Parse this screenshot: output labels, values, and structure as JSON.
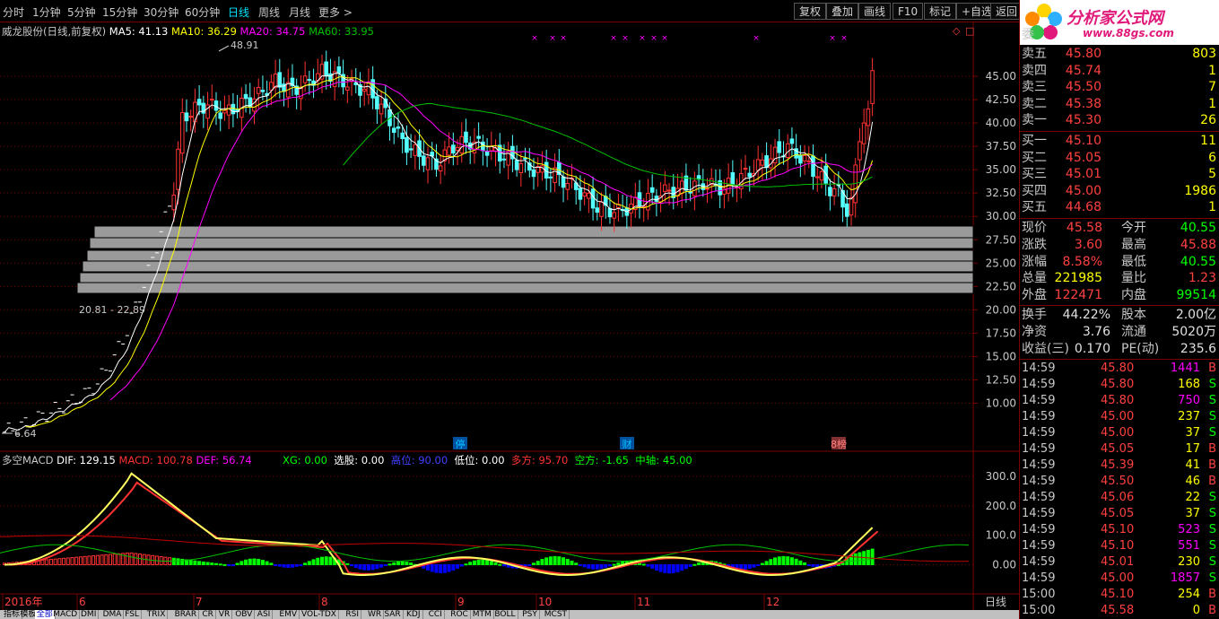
{
  "toolbar": {
    "periods": [
      "分时",
      "1分钟",
      "5分钟",
      "15分钟",
      "30分钟",
      "60分钟",
      "日线",
      "周线",
      "月线",
      "更多 >"
    ],
    "active_period": "日线",
    "buttons": [
      "复权",
      "叠加",
      "画线",
      "F10",
      "标记",
      "+自选",
      "返回"
    ]
  },
  "main_info": {
    "stock": "威龙股份(日线,前复权)",
    "ma5": "MA5: 41.13",
    "ma10": "MA10: 36.29",
    "ma20": "MA20: 34.75",
    "ma60": "MA60: 33.95"
  },
  "annotations": {
    "high": "48.91",
    "low": "6.64",
    "range": "20.81 - 22.89",
    "marker_ting": "停",
    "marker_cai": "财",
    "marker_ji": "8榜"
  },
  "macd_info": {
    "name": "多空MACD",
    "dif": "DIF: 129.15",
    "macd": "MACD: 100.78",
    "def": "DEF: 56.74",
    "xg": "XG: 0.00",
    "xuangu": "选股: 0.00",
    "gaowei": "高位: 90.00",
    "diwei": "低位: 0.00",
    "duofang": "多方: 95.70",
    "kongfang": "空方: -1.65",
    "zhongzhou": "中轴: 45.00"
  },
  "price_axis": [
    "45.00",
    "42.50",
    "40.00",
    "37.50",
    "35.00",
    "32.50",
    "30.00",
    "27.50",
    "25.00",
    "22.50",
    "20.00",
    "17.50",
    "15.00",
    "12.50",
    "10.00"
  ],
  "macd_axis": [
    "300.0",
    "200.0",
    "100.0",
    "0.00"
  ],
  "time_axis": [
    "2016年",
    "6",
    "7",
    "8",
    "9",
    "10",
    "11",
    "12"
  ],
  "time_axis_right": "日线",
  "logo": {
    "text": "分析家公式网",
    "url": "www.88gs.com"
  },
  "orderbook": {
    "header": "委",
    "sells": [
      {
        "label": "卖五",
        "price": "45.80",
        "vol": "803"
      },
      {
        "label": "卖四",
        "price": "45.74",
        "vol": "1"
      },
      {
        "label": "卖三",
        "price": "45.50",
        "vol": "7"
      },
      {
        "label": "卖二",
        "price": "45.38",
        "vol": "1"
      },
      {
        "label": "卖一",
        "price": "45.30",
        "vol": "26"
      }
    ],
    "buys": [
      {
        "label": "买一",
        "price": "45.10",
        "vol": "11"
      },
      {
        "label": "买二",
        "price": "45.05",
        "vol": "6"
      },
      {
        "label": "买三",
        "price": "45.01",
        "vol": "5"
      },
      {
        "label": "买四",
        "price": "45.00",
        "vol": "1986"
      },
      {
        "label": "买五",
        "price": "44.68",
        "vol": "1"
      }
    ]
  },
  "quote": [
    {
      "k1": "现价",
      "v1": "45.58",
      "k2": "今开",
      "v2": "40.55",
      "c1": "#ff4040",
      "c2": "#00ff00"
    },
    {
      "k1": "涨跌",
      "v1": "3.60",
      "k2": "最高",
      "v2": "45.88",
      "c1": "#ff4040",
      "c2": "#ff4040"
    },
    {
      "k1": "涨幅",
      "v1": "8.58%",
      "k2": "最低",
      "v2": "40.55",
      "c1": "#ff4040",
      "c2": "#00ff00"
    },
    {
      "k1": "总量",
      "v1": "221985",
      "k2": "量比",
      "v2": "1.23",
      "c1": "#ffff00",
      "c2": "#ff4040"
    },
    {
      "k1": "外盘",
      "v1": "122471",
      "k2": "内盘",
      "v2": "99514",
      "c1": "#ff4040",
      "c2": "#00ff00"
    }
  ],
  "fundamentals": [
    {
      "k1": "换手",
      "v1": "44.22%",
      "k2": "股本",
      "v2": "2.00亿"
    },
    {
      "k1": "净资",
      "v1": "3.76",
      "k2": "流通",
      "v2": "5020万"
    },
    {
      "k1": "收益(三)",
      "v1": "0.170",
      "k2": "PE(动)",
      "v2": "235.6"
    }
  ],
  "ticks": [
    {
      "time": "14:59",
      "price": "45.80",
      "vol": "1441",
      "side": "B",
      "vc": "#ff00ff"
    },
    {
      "time": "14:59",
      "price": "45.80",
      "vol": "168",
      "side": "S",
      "vc": "#ffff00"
    },
    {
      "time": "14:59",
      "price": "45.80",
      "vol": "750",
      "side": "S",
      "vc": "#ff00ff"
    },
    {
      "time": "14:59",
      "price": "45.00",
      "vol": "237",
      "side": "S",
      "vc": "#ffff00"
    },
    {
      "time": "14:59",
      "price": "45.00",
      "vol": "37",
      "side": "S",
      "vc": "#ffff00"
    },
    {
      "time": "14:59",
      "price": "45.05",
      "vol": "17",
      "side": "B",
      "vc": "#ffff00"
    },
    {
      "time": "14:59",
      "price": "45.39",
      "vol": "41",
      "side": "B",
      "vc": "#ffff00"
    },
    {
      "time": "14:59",
      "price": "45.50",
      "vol": "46",
      "side": "B",
      "vc": "#ffff00"
    },
    {
      "time": "14:59",
      "price": "45.06",
      "vol": "22",
      "side": "S",
      "vc": "#ffff00"
    },
    {
      "time": "14:59",
      "price": "45.05",
      "vol": "37",
      "side": "S",
      "vc": "#ffff00"
    },
    {
      "time": "14:59",
      "price": "45.10",
      "vol": "523",
      "side": "S",
      "vc": "#ff00ff"
    },
    {
      "time": "14:59",
      "price": "45.10",
      "vol": "551",
      "side": "S",
      "vc": "#ff00ff"
    },
    {
      "time": "14:59",
      "price": "45.01",
      "vol": "230",
      "side": "S",
      "vc": "#ffff00"
    },
    {
      "time": "14:59",
      "price": "45.00",
      "vol": "1857",
      "side": "S",
      "vc": "#ff00ff"
    },
    {
      "time": "15:00",
      "price": "45.10",
      "vol": "254",
      "side": "B",
      "vc": "#ffff00"
    },
    {
      "time": "15:00",
      "price": "45.58",
      "vol": "0",
      "side": "B",
      "vc": "#ffff00"
    }
  ],
  "bottom_tabs": [
    "指标",
    "模板",
    "全部",
    "MACD",
    "DMI",
    "DMA",
    "FSL",
    "TRIX",
    "BRAR",
    "CR",
    "VR",
    "OBV",
    "ASI",
    "EMV",
    "VOL-TDX",
    "RSI",
    "WR",
    "SAR",
    "KDJ",
    "CCI",
    "ROC",
    "MTM",
    "BOLL",
    "PSY",
    "MCST"
  ],
  "bottom_tab_active": "全部",
  "colors": {
    "up": "#ff3232",
    "down": "#54ffff",
    "ma5": "#ffffff",
    "ma10": "#ffff00",
    "ma20": "#ff00ff",
    "ma60": "#00c000",
    "grid": "#7a0000",
    "chip_bar": "#9a9a9a"
  }
}
